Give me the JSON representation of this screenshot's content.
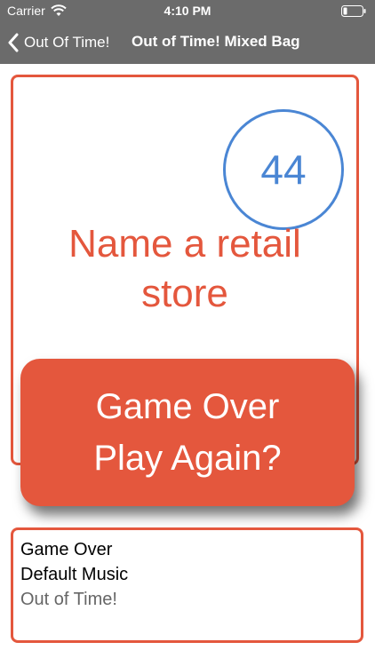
{
  "status_bar": {
    "carrier": "Carrier",
    "time": "4:10 PM",
    "wifi_icon": "wifi-icon",
    "battery_icon": "battery-icon"
  },
  "nav": {
    "back_label": "Out Of Time!",
    "title": "Out of Time! Mixed Bag"
  },
  "card": {
    "timer": "44",
    "prompt": "Name a retail store"
  },
  "overlay": {
    "line1": "Game Over",
    "line2": "Play Again?"
  },
  "info": {
    "line1": "Game Over",
    "line2": "Default Music",
    "line3": "Out of Time!"
  },
  "colors": {
    "accent": "#e4573d",
    "timer": "#4a86d4",
    "bar": "#6b6b6b"
  }
}
